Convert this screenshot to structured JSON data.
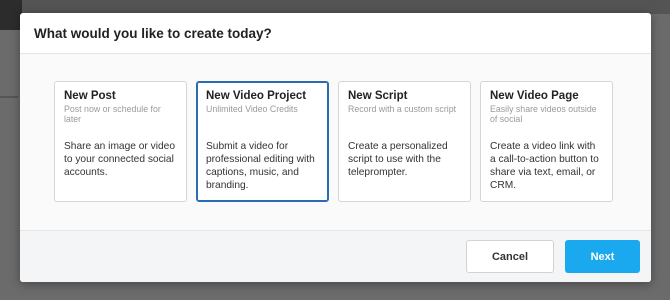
{
  "dialog": {
    "title": "What would you like to create today?"
  },
  "cards": [
    {
      "title": "New Post",
      "subtitle": "Post now or schedule for later",
      "description": "Share an image or video to your connected social accounts."
    },
    {
      "title": "New Video Project",
      "subtitle": "Unlimited Video Credits",
      "description": "Submit a video for professional editing with captions, music, and branding."
    },
    {
      "title": "New Script",
      "subtitle": "Record with a custom script",
      "description": "Create a personalized script to use with the teleprompter."
    },
    {
      "title": "New Video Page",
      "subtitle": "Easily share videos outside of social",
      "description": "Create a video link with a call-to-action button to share via text, email, or CRM."
    }
  ],
  "selected_card_index": 1,
  "footer": {
    "cancel_label": "Cancel",
    "next_label": "Next"
  },
  "colors": {
    "primary_button": "#1aa9ee",
    "selected_border": "#2b6cb0"
  }
}
